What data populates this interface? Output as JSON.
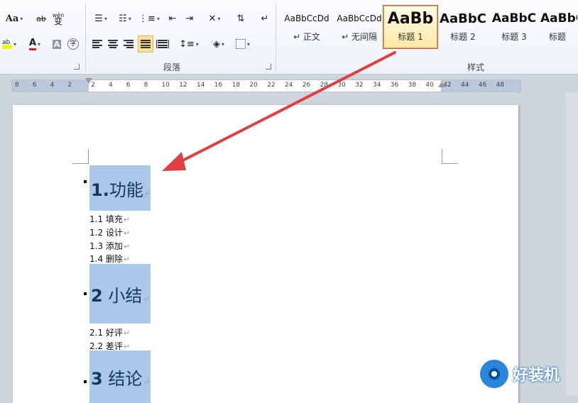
{
  "ribbon": {
    "font_group": {
      "font_size_btn": "Aa",
      "clear_format": "ab",
      "phonetic": "wén",
      "phonetic_char": "变"
    },
    "paragraph_group": {
      "label": "段落"
    },
    "styles_group": {
      "label": "样式",
      "tiles": [
        {
          "preview": "AaBbCcDd",
          "name": "↵ 正文"
        },
        {
          "preview": "AaBbCcDd",
          "name": "↵ 无间隔"
        },
        {
          "preview": "AaBb",
          "name": "标题 1"
        },
        {
          "preview": "AaBbC",
          "name": "标题 2"
        },
        {
          "preview": "AaBbC",
          "name": "标题 3"
        },
        {
          "preview": "AaBbC",
          "name": "标题"
        }
      ]
    }
  },
  "ruler": {
    "numbers": [
      "8",
      "6",
      "4",
      "2",
      "2",
      "4",
      "6",
      "8",
      "10",
      "12",
      "14",
      "16",
      "18",
      "20",
      "22",
      "24",
      "26",
      "28",
      "30",
      "32",
      "34",
      "36",
      "38",
      "40",
      "42",
      "44",
      "46",
      "48"
    ]
  },
  "document": {
    "headings": [
      {
        "num": "1.",
        "text": "功能"
      },
      {
        "num": "2",
        "text": " 小结"
      },
      {
        "num": "3",
        "text": " 结论"
      }
    ],
    "items1": [
      "1.1 填充",
      "1.2 设计",
      "1.3 添加",
      "1.4 删除"
    ],
    "items2": [
      "2.1 好评",
      "2.2 差评"
    ],
    "para_mark": "↵"
  },
  "watermark": {
    "text": "好装机"
  },
  "colors": {
    "heading_highlight": "#a9c8ea",
    "heading_text": "#17375e",
    "arrow": "#e04040",
    "selected_style_border": "#d9534f"
  }
}
